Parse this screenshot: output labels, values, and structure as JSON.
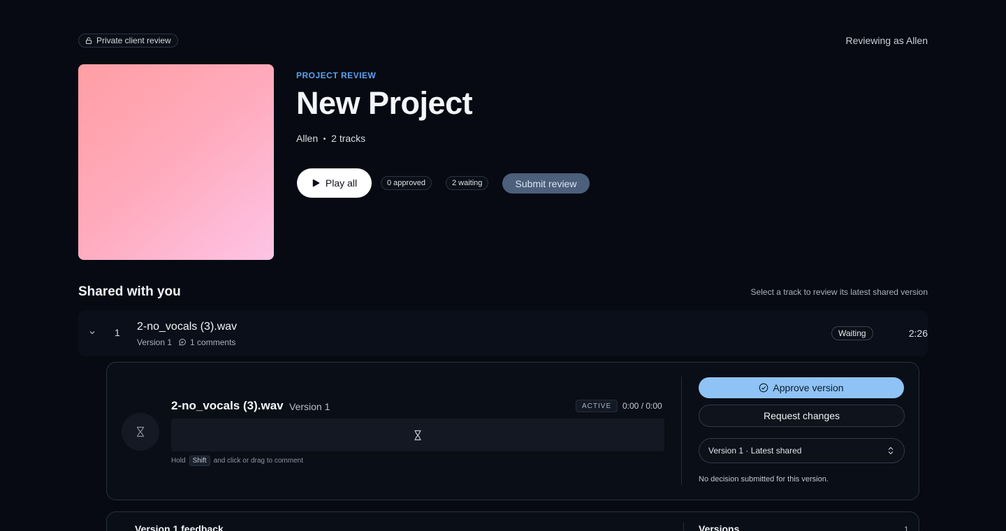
{
  "header": {
    "private_label": "Private client review",
    "reviewing_as": "Reviewing as Allen"
  },
  "project": {
    "eyebrow": "PROJECT REVIEW",
    "title": "New Project",
    "owner": "Allen",
    "track_count": "2 tracks",
    "cover_colors": [
      "#ff9ea4",
      "#ffabbd",
      "#fdc4e6"
    ]
  },
  "actions": {
    "play_all": "Play all",
    "approved_count": "0 approved",
    "waiting_count": "2 waiting",
    "submit_review": "Submit review"
  },
  "shared": {
    "title": "Shared with you",
    "hint": "Select a track to review its latest shared version"
  },
  "track": {
    "number": "1",
    "name": "2-no_vocals (3).wav",
    "version": "Version 1",
    "comments": "1 comments",
    "status": "Waiting",
    "duration": "2:26"
  },
  "player": {
    "name": "2-no_vocals (3).wav",
    "version": "Version 1",
    "active_badge": "ACTIVE",
    "time": "0:00 / 0:00",
    "hint_prefix": "Hold",
    "hint_key": "Shift",
    "hint_suffix": "and click or drag to comment"
  },
  "review": {
    "approve": "Approve version",
    "request_changes": "Request changes",
    "version_select": "Version 1 · Latest shared",
    "decision_note": "No decision submitted for this version."
  },
  "feedback": {
    "title": "Version 1 feedback",
    "versions_title": "Versions",
    "versions_count": "1"
  },
  "colors": {
    "background": "#070a12",
    "accent": "#5aa3f0",
    "approve": "#8fc3f5",
    "submit": "#4c5f7b"
  }
}
